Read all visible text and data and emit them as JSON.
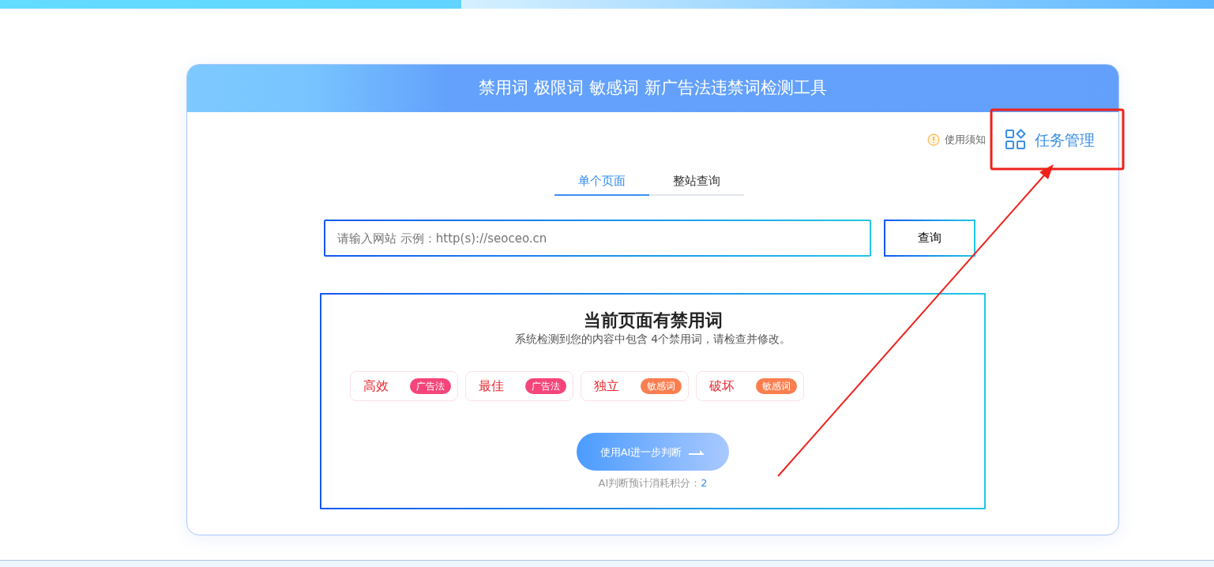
{
  "header": {
    "title": "禁用词 极限词 敏感词 新广告法违禁词检测工具"
  },
  "notice_link": "使用须知",
  "task_button": {
    "label": "任务管理"
  },
  "tabs": [
    {
      "label": "单个页面",
      "selected": true
    },
    {
      "label": "整站查询",
      "selected": false
    }
  ],
  "search": {
    "placeholder": "请输入网站 示例：http(s)://seoceo.cn",
    "button": "查询"
  },
  "result": {
    "title": "当前页面有禁用词",
    "summary": "系统检测到您的内容中包含 4个禁用词，请检查并修改。",
    "words": [
      {
        "word": "高效",
        "tag": "广告法",
        "color": "#f5457a"
      },
      {
        "word": "最佳",
        "tag": "广告法",
        "color": "#f5457a"
      },
      {
        "word": "独立",
        "tag": "敏感词",
        "color": "#fb7e4f"
      },
      {
        "word": "破坏",
        "tag": "敏感词",
        "color": "#fb7e4f"
      }
    ],
    "ai_button": "使用AI进一步判断",
    "cost_label": "AI判断预计消耗积分：",
    "cost_value": "2"
  }
}
